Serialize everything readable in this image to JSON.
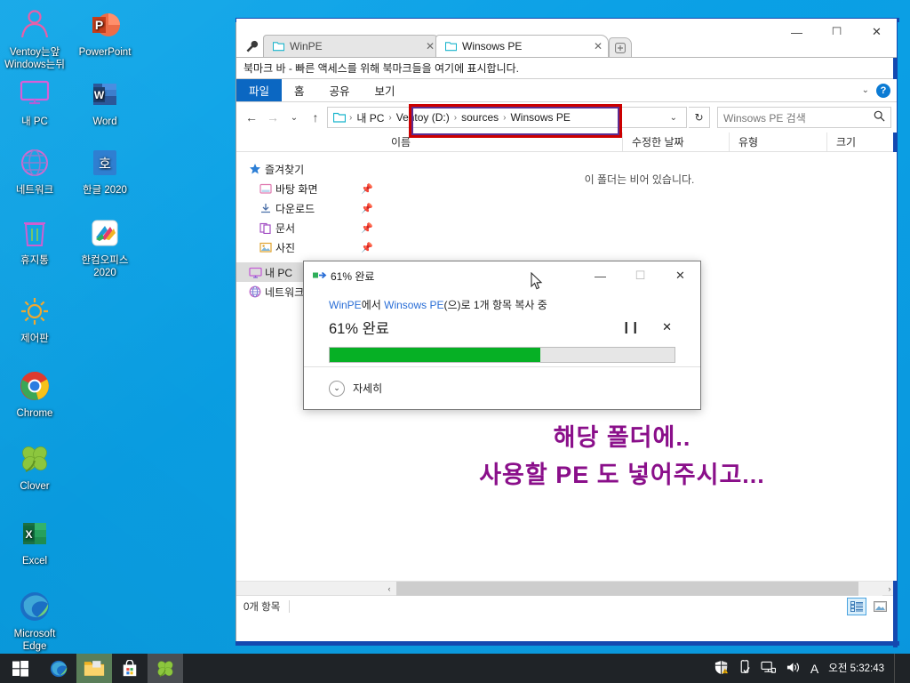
{
  "desktop": {
    "icons": [
      {
        "name": "ventoy-note",
        "label": "Ventoy는앞\nWindows는뒤",
        "icon": "person-icon"
      },
      {
        "name": "powerpoint",
        "label": "PowerPoint",
        "icon": "powerpoint-icon"
      },
      {
        "name": "my-pc",
        "label": "내 PC",
        "icon": "monitor-icon"
      },
      {
        "name": "word",
        "label": "Word",
        "icon": "word-icon"
      },
      {
        "name": "network",
        "label": "네트워크",
        "icon": "globe-icon"
      },
      {
        "name": "hangul-2020",
        "label": "한글 2020",
        "icon": "hangul-icon"
      },
      {
        "name": "recycle-bin",
        "label": "휴지통",
        "icon": "trash-icon"
      },
      {
        "name": "hancom-office",
        "label": "한컴오피스\n2020",
        "icon": "hancom-icon"
      },
      {
        "name": "control-panel",
        "label": "제어판",
        "icon": "gear-icon"
      },
      {
        "name": "chrome",
        "label": "Chrome",
        "icon": "chrome-icon"
      },
      {
        "name": "clover",
        "label": "Clover",
        "icon": "clover-icon"
      },
      {
        "name": "excel",
        "label": "Excel",
        "icon": "excel-icon"
      },
      {
        "name": "microsoft-edge",
        "label": "Microsoft\nEdge",
        "icon": "edge-icon"
      }
    ]
  },
  "explorer": {
    "window_controls": {
      "minimize": "—",
      "maximize": "☐",
      "close": "✕"
    },
    "tabs": [
      {
        "label": "WinPE",
        "close": "✕",
        "active": false
      },
      {
        "label": "Winsows PE",
        "close": "✕",
        "active": true
      }
    ],
    "new_tab_label": "+",
    "bookmark_bar": "북마크 바 - 빠른 액세스를 위해 북마크들을 여기에 표시합니다.",
    "ribbon": {
      "file": "파일",
      "home": "홈",
      "share": "공유",
      "view": "보기",
      "chevron": "⌄",
      "help": "?"
    },
    "address": {
      "back": "←",
      "forward": "→",
      "recent": "⌄",
      "up": "↑",
      "root_label": "내 PC",
      "crumbs": [
        "Ventoy (D:)",
        "sources",
        "Winsows PE"
      ],
      "separator": "›",
      "dropdown": "⌄",
      "refresh": "↻"
    },
    "search": {
      "placeholder": "Winsows PE 검색",
      "icon": "⌕"
    },
    "columns": [
      "이름",
      "수정한 날짜",
      "유형",
      "크기"
    ],
    "nav_pane": [
      {
        "label": "즐겨찾기",
        "icon": "star-icon",
        "pinned": false,
        "level": 0,
        "selected": false
      },
      {
        "label": "바탕 화면",
        "icon": "desktop-icon",
        "pinned": true,
        "level": 1,
        "selected": false
      },
      {
        "label": "다운로드",
        "icon": "download-icon",
        "pinned": true,
        "level": 1,
        "selected": false
      },
      {
        "label": "문서",
        "icon": "documents-icon",
        "pinned": true,
        "level": 1,
        "selected": false
      },
      {
        "label": "사진",
        "icon": "pictures-icon",
        "pinned": true,
        "level": 1,
        "selected": false
      },
      {
        "label": "내 PC",
        "icon": "monitor-icon",
        "pinned": false,
        "level": 0,
        "selected": true
      },
      {
        "label": "네트워크",
        "icon": "globe-icon",
        "pinned": false,
        "level": 0,
        "selected": false
      }
    ],
    "empty_message": "이 폴더는 비어 있습니다.",
    "annotation": {
      "line1": "해당 폴더에..",
      "line2": "사용할 PE 도 넣어주시고...",
      "color": "#8a0f8a"
    },
    "status": {
      "items_count": "0개 항목"
    },
    "view_toggles": {
      "details": "details-view-icon",
      "thumbnails": "thumbnails-view-icon"
    },
    "hscroll": {
      "left_arrow": "‹",
      "right_arrow": "›"
    }
  },
  "copy_dialog": {
    "title": "61% 완료",
    "controls": {
      "minimize": "—",
      "maximize": "☐",
      "close": "✕"
    },
    "source": "WinPE",
    "from_text": "에서",
    "destination": "Winsows PE",
    "operation_text": "(으)로 1개 항목 복사 중",
    "percent_label": "61% 완료",
    "progress_percent": 61,
    "progress_color": "#06b025",
    "pause": "❙❙",
    "cancel": "✕",
    "details_label": "자세히",
    "details_chevron": "⌄"
  },
  "taskbar": {
    "start": "start-icon",
    "items": [
      {
        "name": "edge",
        "icon": "edge-icon",
        "running": false
      },
      {
        "name": "file-explorer",
        "icon": "folder-icon",
        "running": true
      },
      {
        "name": "microsoft-store",
        "icon": "store-icon",
        "running": false
      },
      {
        "name": "clover",
        "icon": "clover-icon",
        "running": true
      }
    ],
    "tray": [
      {
        "name": "security-shield-icon"
      },
      {
        "name": "usb-eject-icon"
      },
      {
        "name": "network-icon"
      },
      {
        "name": "volume-icon"
      },
      {
        "name": "ime-indicator",
        "label": "A"
      }
    ],
    "clock": {
      "period": "오전",
      "time": "5:32:43"
    }
  }
}
